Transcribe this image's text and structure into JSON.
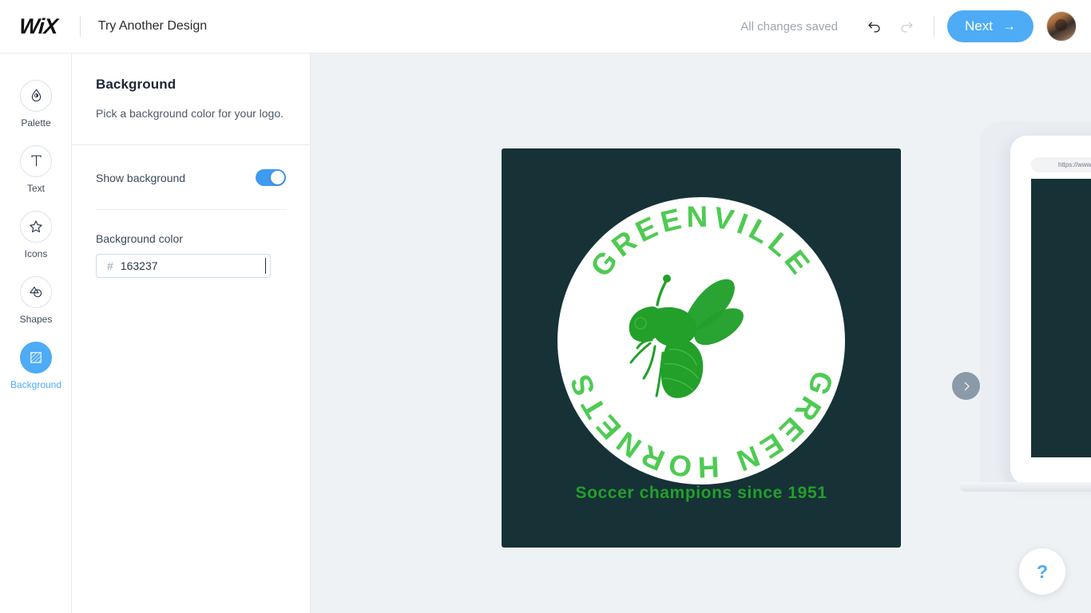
{
  "header": {
    "brand": "WiX",
    "page_title": "Try Another Design",
    "save_status": "All changes saved",
    "undo_icon": "undo-arrow-icon",
    "redo_icon": "redo-arrow-icon",
    "next_label": "Next",
    "next_arrow": "→",
    "avatar_alt": "user-avatar"
  },
  "sidebar": {
    "items": [
      {
        "label": "Palette",
        "icon": "droplet-icon",
        "active": false
      },
      {
        "label": "Text",
        "icon": "text-t-icon",
        "active": false
      },
      {
        "label": "Icons",
        "icon": "star-icon",
        "active": false
      },
      {
        "label": "Shapes",
        "icon": "shapes-icon",
        "active": false
      },
      {
        "label": "Background",
        "icon": "background-hatch-icon",
        "active": true
      }
    ]
  },
  "panel": {
    "title": "Background",
    "subtitle": "Pick a background color for your logo.",
    "show_background_label": "Show background",
    "show_background_on": true,
    "background_color_label": "Background color",
    "hash_symbol": "#",
    "hex_value": "163237",
    "swatch_color": "#163237"
  },
  "logo": {
    "background_color": "#163237",
    "circle_color": "#ffffff",
    "arc_text_top": "GREENVILLE",
    "arc_text_bottom": "GREEN HORNETS",
    "arc_text_full": "GREENVILLE GREEN HORNETS",
    "arc_text_color": "#4ecb52",
    "mascot_icon": "hornet-bee-icon",
    "mascot_color": "#22a02a",
    "tagline": "Soccer champions since 1951",
    "tagline_color": "#22a02a"
  },
  "preview": {
    "url_text": "https://www.m",
    "next_arrow_icon": "chevron-right-icon",
    "screen_color": "#163237"
  },
  "help": {
    "label": "?",
    "icon": "question-mark-icon"
  },
  "colors": {
    "accent_blue": "#4eabf5",
    "canvas_bg": "#eff2f5",
    "dark_teal": "#163237",
    "bright_green": "#4ecb52",
    "deep_green": "#22a02a"
  }
}
